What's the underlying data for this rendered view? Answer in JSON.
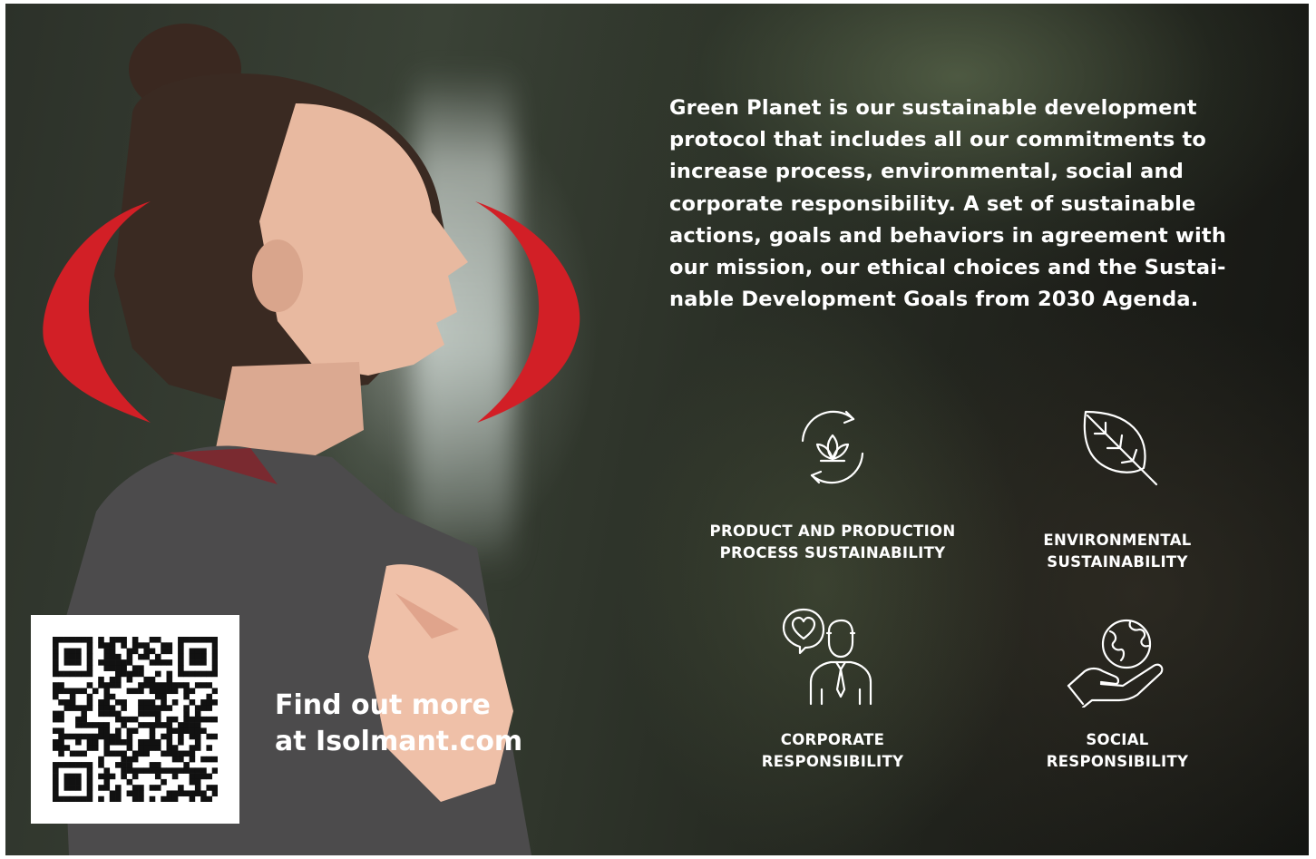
{
  "intro": {
    "lines": [
      "Green Planet is our sustainable development",
      "protocol that includes all our commitments to",
      "increase process, environmental, social and",
      "corporate responsibility. A set of sustainable",
      "actions, goals and behaviors in agreement with",
      "our mission, our ethical choices and the Sustai-",
      "nable Development Goals from 2030 Agenda."
    ]
  },
  "pillars": [
    {
      "icon": "recycle-lotus-icon",
      "line1": "PRODUCT AND PRODUCTION",
      "line2": "PROCESS SUSTAINABILITY"
    },
    {
      "icon": "leaf-icon",
      "line1": "ENVIRONMENTAL",
      "line2": "SUSTAINABILITY"
    },
    {
      "icon": "businessman-heart-icon",
      "line1": "CORPORATE",
      "line2": "RESPONSIBILITY"
    },
    {
      "icon": "hand-globe-icon",
      "line1": "SOCIAL",
      "line2": "RESPONSIBILITY"
    }
  ],
  "cta": {
    "line1": "Find out more",
    "line2": "at Isolmant.com"
  },
  "colors": {
    "accent_red": "#d21f26",
    "text": "#ffffff",
    "qr_dark": "#111111"
  }
}
